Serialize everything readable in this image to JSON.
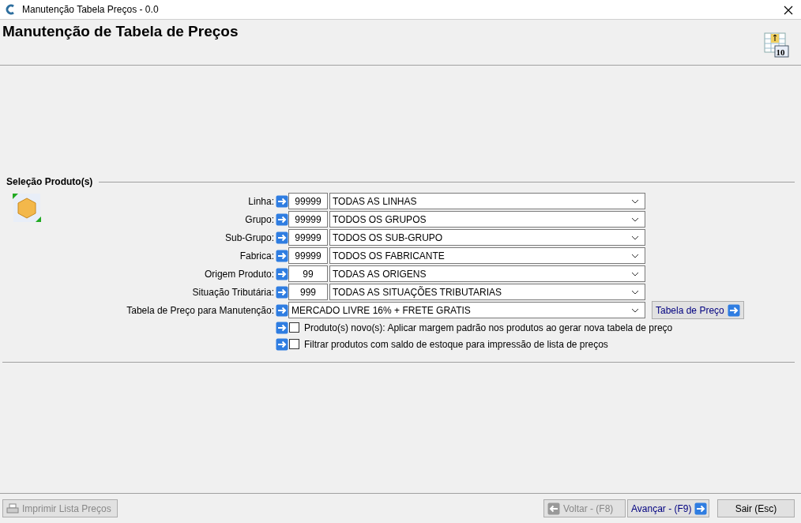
{
  "window": {
    "title": "Manutenção Tabela Preços - 0.0"
  },
  "header": {
    "title": "Manutenção de Tabela de Preços",
    "icon_badge": "10"
  },
  "section": {
    "title": "Seleção Produto(s)"
  },
  "filters": [
    {
      "label": "Linha:",
      "code": "99999",
      "value": "TODAS AS LINHAS"
    },
    {
      "label": "Grupo:",
      "code": "99999",
      "value": "TODOS OS GRUPOS"
    },
    {
      "label": "Sub-Grupo:",
      "code": "99999",
      "value": "TODOS OS SUB-GRUPO"
    },
    {
      "label": "Fabrica:",
      "code": "99999",
      "value": "TODOS OS FABRICANTE"
    },
    {
      "label": "Origem Produto:",
      "code": "99",
      "value": "TODAS AS ORIGENS"
    },
    {
      "label": "Situação Tributária:",
      "code": "999",
      "value": "TODAS AS SITUAÇÕES TRIBUTARIAS"
    }
  ],
  "price_table": {
    "label": "Tabela de Preço para Manutenção:",
    "value": "MERCADO LIVRE 16% + FRETE GRATIS",
    "button": "Tabela de Preço"
  },
  "options": [
    {
      "label": "Produto(s) novo(s): Aplicar margem padrão nos produtos ao gerar nova tabela de preço",
      "checked": false
    },
    {
      "label": "Filtrar produtos com saldo de estoque para impressão de lista de preços",
      "checked": false
    }
  ],
  "footer": [
    {
      "kind": "print",
      "label": "Imprimir Lista Preços",
      "disabled": true
    },
    {
      "kind": "back",
      "label": "Voltar - (F8)",
      "disabled": true
    },
    {
      "kind": "next",
      "label": "Avançar - (F9)",
      "disabled": false
    },
    {
      "kind": "exit",
      "label": "Sair (Esc)",
      "disabled": false
    }
  ]
}
